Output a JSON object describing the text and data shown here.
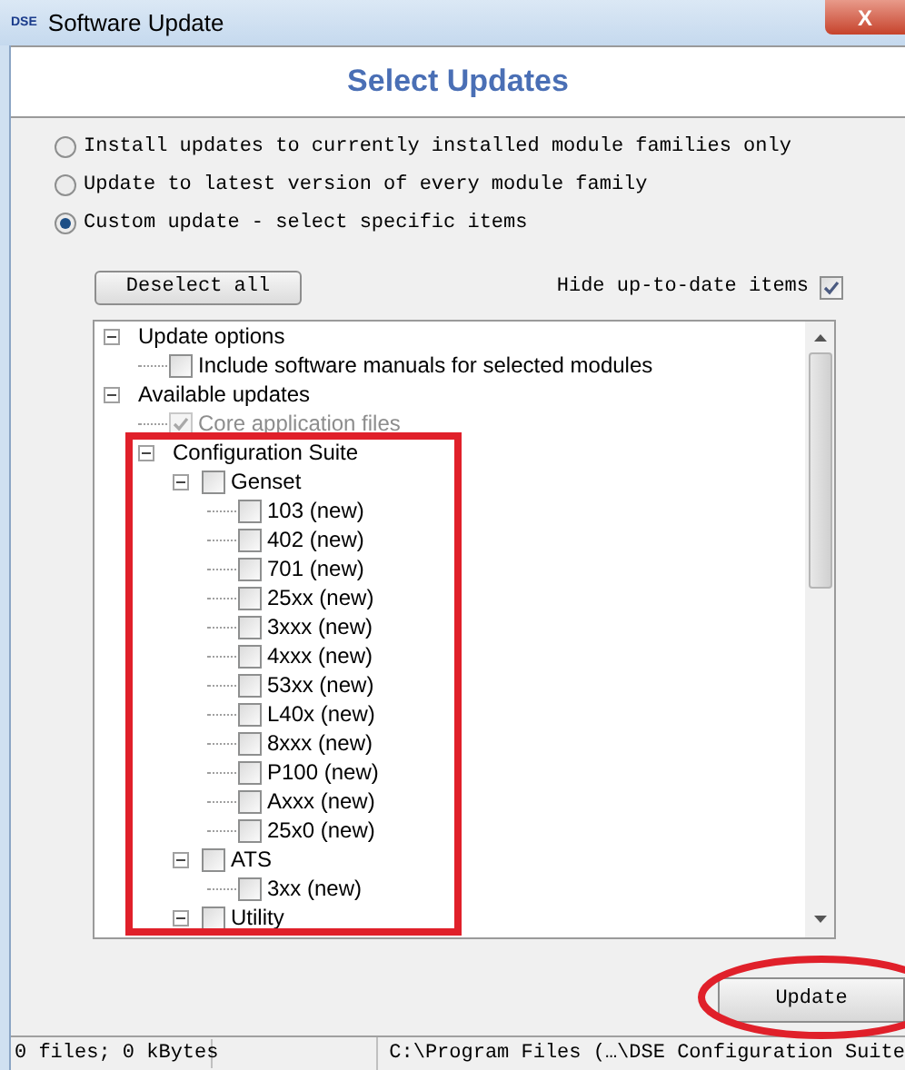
{
  "window": {
    "title": "Software Update",
    "app_icon": "DSE"
  },
  "close_button": "X",
  "header": "Select Updates",
  "options": [
    {
      "label": "Install updates to currently installed module families only",
      "selected": false
    },
    {
      "label": "Update to latest version of every module family",
      "selected": false
    },
    {
      "label": "Custom update - select specific items",
      "selected": true
    }
  ],
  "deselect_button": "Deselect all",
  "hide_up_to_date": {
    "label": "Hide up-to-date items",
    "checked": true
  },
  "tree": [
    {
      "label": "Update options",
      "expanded": true,
      "children": [
        {
          "label": "Include software manuals for selected modules",
          "checked": false,
          "disabled": false
        }
      ]
    },
    {
      "label": "Available updates",
      "expanded": true,
      "children": [
        {
          "label": "Core application files",
          "checked": true,
          "disabled": true
        },
        {
          "label": "Configuration Suite",
          "expanded": true,
          "children": [
            {
              "label": "Genset",
              "checked": false,
              "disabled": false,
              "expanded": true,
              "children": [
                {
                  "label": "103 (new)",
                  "checked": false,
                  "disabled": false
                },
                {
                  "label": "402 (new)",
                  "checked": false,
                  "disabled": false
                },
                {
                  "label": "701 (new)",
                  "checked": false,
                  "disabled": false
                },
                {
                  "label": "25xx (new)",
                  "checked": false,
                  "disabled": false
                },
                {
                  "label": "3xxx (new)",
                  "checked": false,
                  "disabled": false
                },
                {
                  "label": "4xxx (new)",
                  "checked": false,
                  "disabled": false
                },
                {
                  "label": "53xx (new)",
                  "checked": false,
                  "disabled": false
                },
                {
                  "label": "L40x (new)",
                  "checked": false,
                  "disabled": false
                },
                {
                  "label": "8xxx (new)",
                  "checked": false,
                  "disabled": false
                },
                {
                  "label": "P100 (new)",
                  "checked": false,
                  "disabled": false
                },
                {
                  "label": "Axxx (new)",
                  "checked": false,
                  "disabled": false
                },
                {
                  "label": "25x0 (new)",
                  "checked": false,
                  "disabled": false
                }
              ]
            },
            {
              "label": "ATS",
              "checked": false,
              "disabled": false,
              "expanded": true,
              "children": [
                {
                  "label": "3xx (new)",
                  "checked": false,
                  "disabled": false
                }
              ]
            },
            {
              "label": "Utility",
              "checked": false,
              "disabled": false,
              "expanded": true
            }
          ]
        }
      ]
    }
  ],
  "update_button": "Update",
  "status_bar": [
    "0 files; 0 kBytes",
    "C:\\Program Files (…\\DSE Configuration Suite"
  ]
}
